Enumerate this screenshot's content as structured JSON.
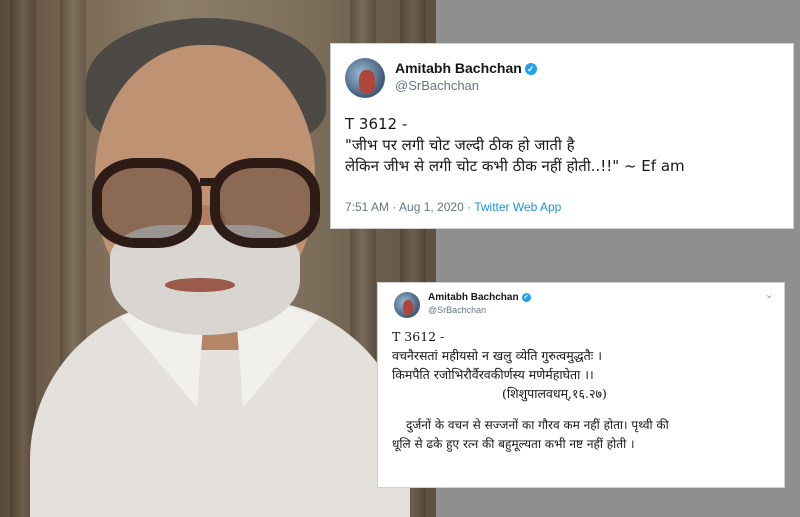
{
  "tweet_top": {
    "name": "Amitabh Bachchan",
    "handle": "@SrBachchan",
    "lines": [
      "T 3612 -",
      "\"जीभ पर लगी चोट जल्दी ठीक हो जाती है",
      "लेकिन जीभ से लगी चोट कभी ठीक नहीं होती..!!\" ~ Ef am"
    ],
    "time": "7:51 AM · Aug 1, 2020 · ",
    "app": "Twitter Web App"
  },
  "tweet_bottom": {
    "name": "Amitabh Bachchan",
    "handle": "@SrBachchan",
    "lines": [
      "T 3612 -",
      "वचनैरसतां महीयसो न खलु व्येति गुरुत्वमुद्धतैः ।",
      "किमपैति रजोभिरौर्वैरवकीर्णस्य मणेर्महाघेता ।।",
      "(शिशुपालवधम्,१६.२७)"
    ],
    "translation": [
      "दुर्जनों के वचन से सज्जनों का गौरव कम नहीं होता। पृथ्वी की",
      "धूलि से ढके हुए रत्न की बहुमूल्यता कभी नष्ट नहीं होती ।"
    ]
  },
  "icons": {
    "verified": "verified-badge-icon",
    "more": "chevron-down-icon"
  },
  "colors": {
    "link": "#1b95e0",
    "verified": "#1da1f2",
    "background": "#8f8f8f"
  }
}
